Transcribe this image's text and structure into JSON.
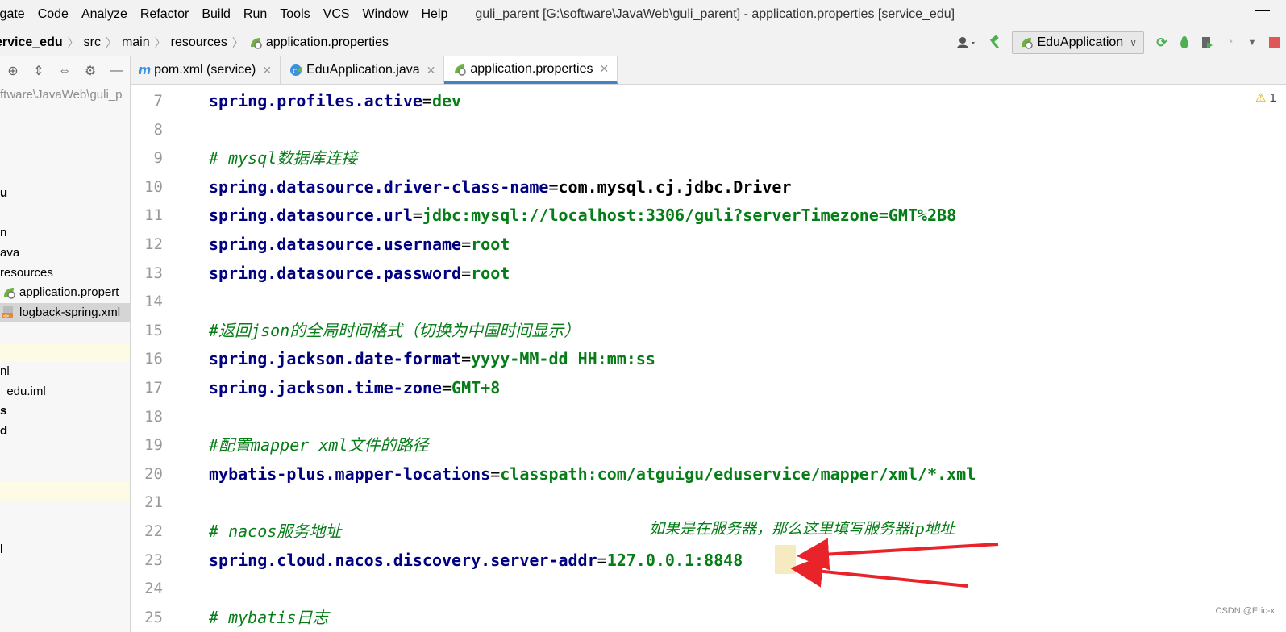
{
  "menu": {
    "items": [
      "igate",
      "Code",
      "Analyze",
      "Refactor",
      "Build",
      "Run",
      "Tools",
      "VCS",
      "Window",
      "Help"
    ],
    "window_title": "guli_parent [G:\\software\\JavaWeb\\guli_parent] - application.properties [service_edu]",
    "minimize": "—"
  },
  "breadcrumb": {
    "project": "ervice_edu",
    "parts": [
      "src",
      "main",
      "resources"
    ],
    "file": "application.properties"
  },
  "toolbar": {
    "run_config": "EduApplication",
    "accent_green": "#4caf50"
  },
  "left_panel": {
    "path": "ftware\\JavaWeb\\guli_p",
    "items": [
      {
        "text": "u",
        "bold": true
      },
      {
        "text": "n",
        "bold": false
      },
      {
        "text": "ava",
        "bold": false
      },
      {
        "text": "resources",
        "bold": false
      },
      {
        "text": "application.propert",
        "bold": false
      },
      {
        "text": "logback-spring.xml",
        "bold": false
      },
      {
        "text": "nl",
        "bold": false
      },
      {
        "text": "_edu.iml",
        "bold": false
      },
      {
        "text": "s",
        "bold": true
      },
      {
        "text": "d",
        "bold": true
      },
      {
        "text": "l",
        "bold": false
      }
    ]
  },
  "tabs": [
    {
      "label": "pom.xml (service)",
      "icon": "maven-icon",
      "active": false
    },
    {
      "label": "EduApplication.java",
      "icon": "spring-class-icon",
      "active": false
    },
    {
      "label": "application.properties",
      "icon": "spring-leaf-icon",
      "active": true
    }
  ],
  "editor": {
    "warning_count": "1",
    "lines": [
      {
        "n": "7",
        "kind": "kv",
        "key": "spring.profiles.active",
        "value": "dev"
      },
      {
        "n": "8",
        "kind": "blank"
      },
      {
        "n": "9",
        "kind": "comment",
        "text": "# mysql数据库连接"
      },
      {
        "n": "10",
        "kind": "kv-dark",
        "key": "spring.datasource.driver-class-name",
        "value": "com.mysql.cj.jdbc.Driver"
      },
      {
        "n": "11",
        "kind": "kv",
        "key": "spring.datasource.url",
        "value": "jdbc:mysql://localhost:3306/guli?serverTimezone=GMT%2B8"
      },
      {
        "n": "12",
        "kind": "kv",
        "key": "spring.datasource.username",
        "value": "root"
      },
      {
        "n": "13",
        "kind": "kv",
        "key": "spring.datasource.password",
        "value": "root"
      },
      {
        "n": "14",
        "kind": "blank"
      },
      {
        "n": "15",
        "kind": "comment",
        "text": "#返回json的全局时间格式（切换为中国时间显示）"
      },
      {
        "n": "16",
        "kind": "kv",
        "key": "spring.jackson.date-format",
        "value": "yyyy-MM-dd HH:mm:ss"
      },
      {
        "n": "17",
        "kind": "kv",
        "key": "spring.jackson.time-zone",
        "value": "GMT+8"
      },
      {
        "n": "18",
        "kind": "blank"
      },
      {
        "n": "19",
        "kind": "comment",
        "text": "#配置mapper xml文件的路径"
      },
      {
        "n": "20",
        "kind": "kv",
        "key": "mybatis-plus.mapper-locations",
        "value": "classpath:com/atguigu/eduservice/mapper/xml/*.xml"
      },
      {
        "n": "21",
        "kind": "blank"
      },
      {
        "n": "22",
        "kind": "comment",
        "text": "# nacos服务地址"
      },
      {
        "n": "23",
        "kind": "kv",
        "key": "spring.cloud.nacos.discovery.server-addr",
        "value": "127.0.0.1:8848"
      },
      {
        "n": "24",
        "kind": "blank"
      },
      {
        "n": "25",
        "kind": "comment",
        "text": "# mybatis日志"
      }
    ],
    "annotation": "如果是在服务器，那么这里填写服务器ip地址"
  },
  "watermark": "CSDN @Eric-x",
  "colors": {
    "key": "#000080",
    "value": "#067d17",
    "arrow": "#e8232a",
    "current_line": "#fdfbe6"
  }
}
